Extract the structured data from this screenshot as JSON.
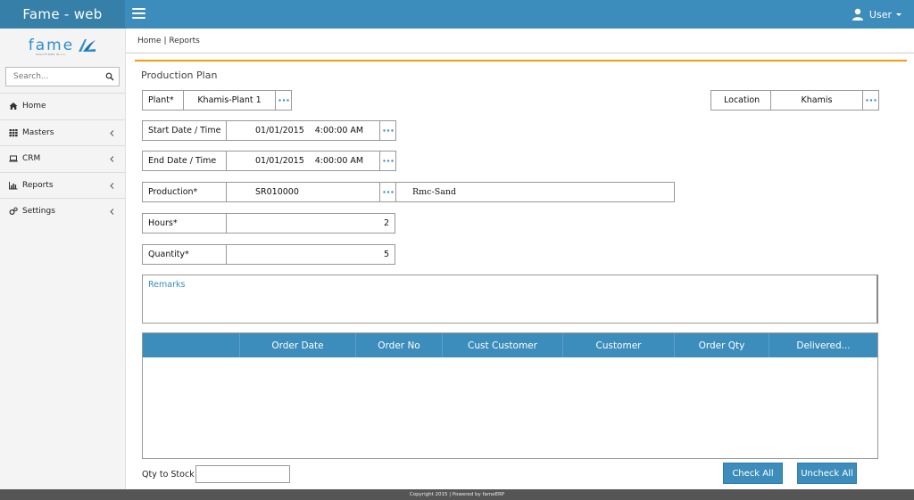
{
  "app": {
    "title": "Fame - web",
    "user": "User"
  },
  "logo": {
    "text": "fame",
    "sub": "SOLUTIONS W.L.L."
  },
  "search": {
    "placeholder": "Search..."
  },
  "sidebar": {
    "items": [
      {
        "label": "Home",
        "icon": "home-icon"
      },
      {
        "label": "Masters",
        "icon": "grid-icon"
      },
      {
        "label": "CRM",
        "icon": "laptop-icon"
      },
      {
        "label": "Reports",
        "icon": "bar-chart-icon"
      },
      {
        "label": "Settings",
        "icon": "gears-icon"
      }
    ]
  },
  "breadcrumb": "Home | Reports",
  "page": {
    "title": "Production Plan"
  },
  "form": {
    "plant": {
      "label": "Plant*",
      "value": "Khamis-Plant 1"
    },
    "location": {
      "label": "Location",
      "value": "Khamis"
    },
    "start": {
      "label": "Start Date / Time",
      "date": "01/01/2015",
      "time": "4:00:00 AM"
    },
    "end": {
      "label": "End Date / Time",
      "date": "01/01/2015",
      "time": "4:00:00 AM"
    },
    "production": {
      "label": "Production*",
      "code": "SR010000",
      "name": "Rmc-Sand"
    },
    "hours": {
      "label": "Hours*",
      "value": "2"
    },
    "quantity": {
      "label": "Quantity*",
      "value": "5"
    },
    "remarks": {
      "label": "Remarks"
    }
  },
  "grid": {
    "columns": [
      "",
      "Order Date",
      "Order No",
      "Cust Customer",
      "Customer",
      "Order Qty",
      "Delivered..."
    ]
  },
  "bottom": {
    "qty_to_stock_label": "Qty to Stock",
    "check_all": "Check All",
    "uncheck_all": "Uncheck All"
  },
  "footer": "Copyright 2015 | Powered by fameERP",
  "colors": {
    "primary": "#3c8dbc",
    "brand_dark": "#367fa9",
    "accent": "#f39c12"
  }
}
